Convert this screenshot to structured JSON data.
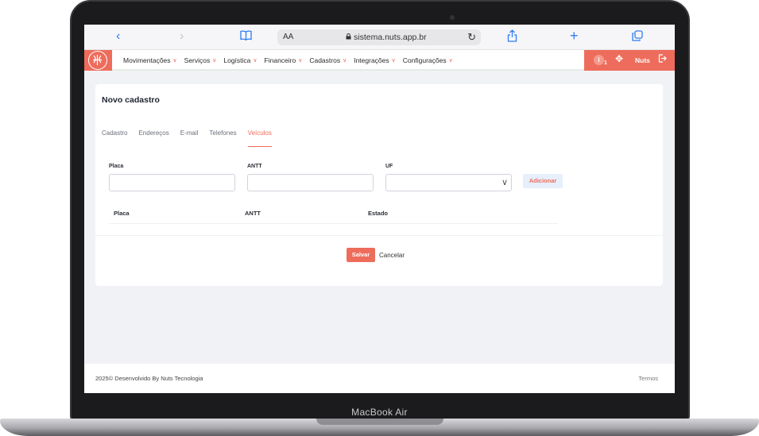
{
  "device": {
    "label": "MacBook Air"
  },
  "browser": {
    "text_size_label": "AA",
    "url": "sistema.nuts.app.br",
    "icons": [
      "chevron-left-icon",
      "chevron-right-icon",
      "book-icon",
      "lock-icon",
      "reload-icon",
      "share-icon",
      "plus-icon",
      "tabs-icon"
    ]
  },
  "nav": {
    "menu": [
      {
        "label": "Movimentações"
      },
      {
        "label": "Serviços"
      },
      {
        "label": "Logística"
      },
      {
        "label": "Financeiro"
      },
      {
        "label": "Cadastros"
      },
      {
        "label": "Integrações"
      },
      {
        "label": "Configurações"
      }
    ],
    "notification_count": "1",
    "info_symbol": "i",
    "user_name": "Nuts",
    "accent": "#ee6c5b"
  },
  "page": {
    "title": "Novo cadastro",
    "tabs": [
      {
        "label": "Cadastro"
      },
      {
        "label": "Endereços"
      },
      {
        "label": "E-mail"
      },
      {
        "label": "Telefones"
      },
      {
        "label": "Veículos"
      }
    ],
    "active_tab": "Veículos",
    "form": {
      "placa_label": "Placa",
      "antt_label": "ANTT",
      "uf_label": "UF",
      "placa_value": "",
      "antt_value": "",
      "uf_value": "",
      "add_button": "Adicionar"
    },
    "table": {
      "headers": [
        "Placa",
        "ANTT",
        "Estado"
      ]
    },
    "actions": {
      "save": "Salvar",
      "cancel": "Cancelar"
    }
  },
  "footer": {
    "text": "2025© Desenvolvido By Nuts Tecnologia",
    "link": "Termos"
  }
}
